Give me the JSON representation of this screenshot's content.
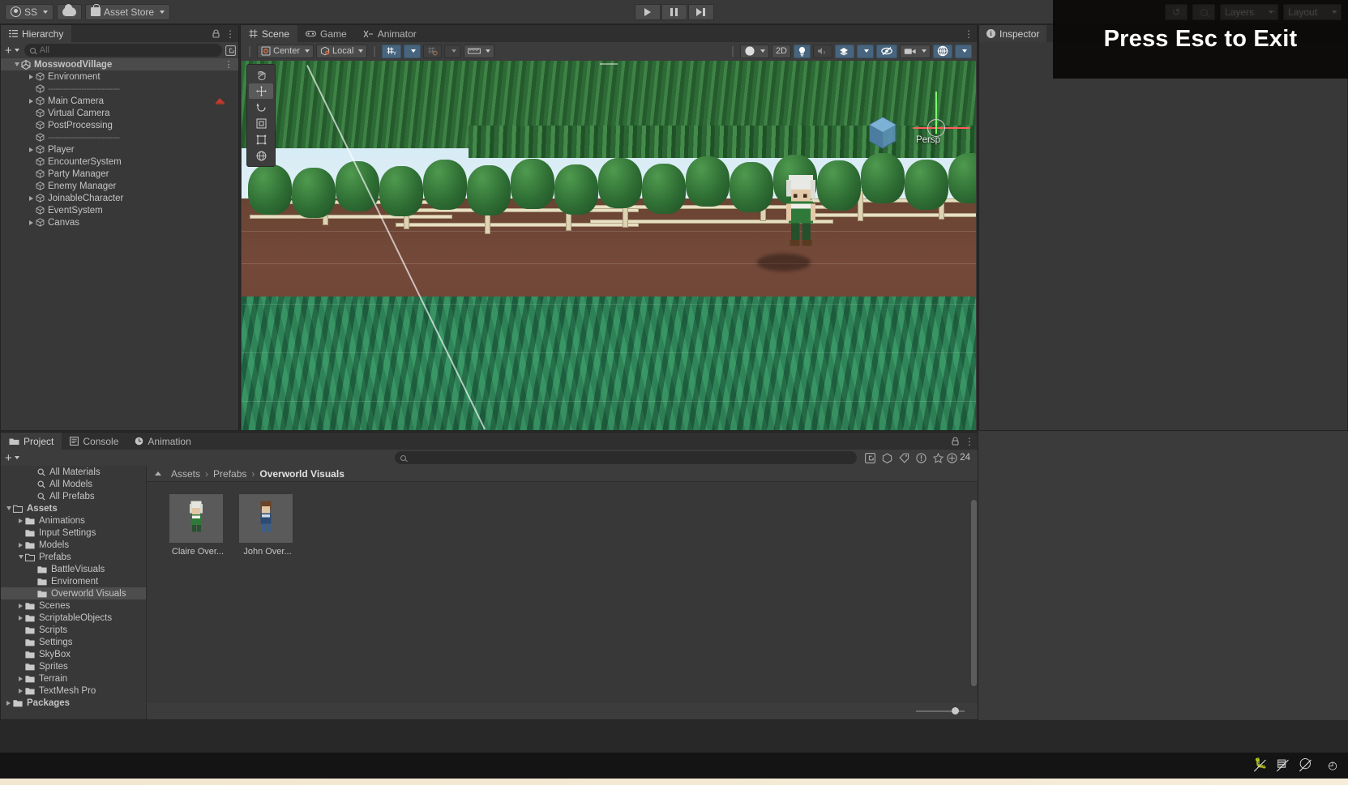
{
  "app": {
    "toolbar": {
      "account_label": "SS",
      "cloud_icon": "cloud-icon",
      "asset_store_label": "Asset Store",
      "play_icon": "play-icon",
      "pause_icon": "pause-icon",
      "step_icon": "step-icon",
      "history_icon": "history-icon",
      "search_icon": "search-icon",
      "layers_label": "Layers",
      "layout_label": "Layout"
    }
  },
  "overlay": {
    "message": "Press Esc to Exit"
  },
  "hierarchy": {
    "tab_label": "Hierarchy",
    "lock_icon": "lock-icon",
    "menu_icon": "kebab-menu-icon",
    "add_label": "+",
    "search_placeholder": "All",
    "rows": [
      {
        "label": "MosswoodVillage",
        "depth": 0,
        "arrow": "open",
        "icon": "unity-logo-icon",
        "selected": true,
        "menu": true
      },
      {
        "label": "Environment",
        "depth": 1,
        "arrow": "closed",
        "icon": "gameobject-icon",
        "selected": false,
        "menu": false
      },
      {
        "label": "----------------------------",
        "depth": 1,
        "arrow": "none",
        "icon": "gameobject-icon",
        "selected": false,
        "menu": false
      },
      {
        "label": "Main Camera",
        "depth": 1,
        "arrow": "closed",
        "icon": "gameobject-icon",
        "selected": false,
        "menu": false,
        "badge": "camera-preview-badge"
      },
      {
        "label": "Virtual Camera",
        "depth": 1,
        "arrow": "none",
        "icon": "gameobject-icon",
        "selected": false,
        "menu": false
      },
      {
        "label": "PostProcessing",
        "depth": 1,
        "arrow": "none",
        "icon": "gameobject-icon",
        "selected": false,
        "menu": false
      },
      {
        "label": "----------------------------",
        "depth": 1,
        "arrow": "none",
        "icon": "gameobject-icon",
        "selected": false,
        "menu": false
      },
      {
        "label": "Player",
        "depth": 1,
        "arrow": "closed",
        "icon": "gameobject-icon",
        "selected": false,
        "menu": false
      },
      {
        "label": "EncounterSystem",
        "depth": 1,
        "arrow": "none",
        "icon": "gameobject-icon",
        "selected": false,
        "menu": false
      },
      {
        "label": "Party Manager",
        "depth": 1,
        "arrow": "none",
        "icon": "gameobject-icon",
        "selected": false,
        "menu": false
      },
      {
        "label": "Enemy Manager",
        "depth": 1,
        "arrow": "none",
        "icon": "gameobject-icon",
        "selected": false,
        "menu": false
      },
      {
        "label": "JoinableCharacter",
        "depth": 1,
        "arrow": "closed",
        "icon": "gameobject-icon",
        "selected": false,
        "menu": false
      },
      {
        "label": "EventSystem",
        "depth": 1,
        "arrow": "none",
        "icon": "gameobject-icon",
        "selected": false,
        "menu": false
      },
      {
        "label": "Canvas",
        "depth": 1,
        "arrow": "closed",
        "icon": "gameobject-icon",
        "selected": false,
        "menu": false
      }
    ]
  },
  "scene": {
    "tabs": [
      {
        "label": "Scene",
        "icon": "grid-icon",
        "active": true
      },
      {
        "label": "Game",
        "icon": "gamepad-icon",
        "active": false
      },
      {
        "label": "Animator",
        "icon": "animator-icon",
        "active": false
      }
    ],
    "menu_icon": "kebab-menu-icon",
    "toolbar": {
      "pivot_label": "Center",
      "handle_label": "Local",
      "grid_icon": "grid-axis-icon",
      "snap_icon": "grid-snap-icon",
      "ruler_icon": "ruler-icon",
      "shading_icon": "shading-mode-icon",
      "twod_label": "2D",
      "light_icon": "lighting-icon",
      "audio_icon": "audio-mute-icon",
      "fx_icon": "effects-icon",
      "hidden_icon": "scene-visibility-icon",
      "camera_icon": "scene-camera-icon",
      "gizmos_icon": "gizmos-icon"
    },
    "tools": [
      {
        "icon": "hand-tool-icon",
        "active": false
      },
      {
        "icon": "move-tool-icon",
        "active": true
      },
      {
        "icon": "rotate-tool-icon",
        "active": false
      },
      {
        "icon": "scale-tool-icon",
        "active": false
      },
      {
        "icon": "rect-tool-icon",
        "active": false
      },
      {
        "icon": "transform-tool-icon",
        "active": false
      }
    ],
    "orientation_label": "Persp",
    "gizmo_icon": "orientation-gizmo-icon"
  },
  "inspector": {
    "tab_label": "Inspector",
    "icon": "info-icon",
    "lock_icon": "lock-icon",
    "menu_icon": "kebab-menu-icon"
  },
  "project": {
    "tabs": [
      {
        "label": "Project",
        "icon": "folder-icon",
        "active": true
      },
      {
        "label": "Console",
        "icon": "console-icon",
        "active": false
      },
      {
        "label": "Animation",
        "icon": "animation-clock-icon",
        "active": false
      }
    ],
    "lock_icon": "lock-icon",
    "menu_icon": "kebab-menu-icon",
    "add_label": "+",
    "search_placeholder": "",
    "search_value": "",
    "filter_icons": [
      "save-search-icon",
      "search-by-type-icon",
      "search-by-label-icon",
      "warning-icon",
      "favorite-icon"
    ],
    "item_count": "24",
    "tree": [
      {
        "label": "All Materials",
        "depth": 2,
        "icon": "search-icon",
        "arrow": "none",
        "selected": false,
        "bold": false
      },
      {
        "label": "All Models",
        "depth": 2,
        "icon": "search-icon",
        "arrow": "none",
        "selected": false,
        "bold": false
      },
      {
        "label": "All Prefabs",
        "depth": 2,
        "icon": "search-icon",
        "arrow": "none",
        "selected": false,
        "bold": false
      },
      {
        "label": "Assets",
        "depth": 0,
        "icon": "folder-open-icon",
        "arrow": "open",
        "selected": false,
        "bold": true
      },
      {
        "label": "Animations",
        "depth": 1,
        "icon": "folder-icon",
        "arrow": "closed",
        "selected": false,
        "bold": false
      },
      {
        "label": "Input Settings",
        "depth": 1,
        "icon": "folder-icon",
        "arrow": "none",
        "selected": false,
        "bold": false
      },
      {
        "label": "Models",
        "depth": 1,
        "icon": "folder-icon",
        "arrow": "closed",
        "selected": false,
        "bold": false
      },
      {
        "label": "Prefabs",
        "depth": 1,
        "icon": "folder-open-icon",
        "arrow": "open",
        "selected": false,
        "bold": false
      },
      {
        "label": "BattleVisuals",
        "depth": 2,
        "icon": "folder-icon",
        "arrow": "none",
        "selected": false,
        "bold": false
      },
      {
        "label": "Enviroment",
        "depth": 2,
        "icon": "folder-icon",
        "arrow": "none",
        "selected": false,
        "bold": false
      },
      {
        "label": "Overworld Visuals",
        "depth": 2,
        "icon": "folder-icon",
        "arrow": "none",
        "selected": true,
        "bold": false
      },
      {
        "label": "Scenes",
        "depth": 1,
        "icon": "folder-icon",
        "arrow": "closed",
        "selected": false,
        "bold": false
      },
      {
        "label": "ScriptableObjects",
        "depth": 1,
        "icon": "folder-icon",
        "arrow": "closed",
        "selected": false,
        "bold": false
      },
      {
        "label": "Scripts",
        "depth": 1,
        "icon": "folder-icon",
        "arrow": "none",
        "selected": false,
        "bold": false
      },
      {
        "label": "Settings",
        "depth": 1,
        "icon": "folder-icon",
        "arrow": "none",
        "selected": false,
        "bold": false
      },
      {
        "label": "SkyBox",
        "depth": 1,
        "icon": "folder-icon",
        "arrow": "none",
        "selected": false,
        "bold": false
      },
      {
        "label": "Sprites",
        "depth": 1,
        "icon": "folder-icon",
        "arrow": "none",
        "selected": false,
        "bold": false
      },
      {
        "label": "Terrain",
        "depth": 1,
        "icon": "folder-icon",
        "arrow": "closed",
        "selected": false,
        "bold": false
      },
      {
        "label": "TextMesh Pro",
        "depth": 1,
        "icon": "folder-icon",
        "arrow": "closed",
        "selected": false,
        "bold": false
      },
      {
        "label": "Packages",
        "depth": 0,
        "icon": "folder-icon",
        "arrow": "closed",
        "selected": false,
        "bold": true
      }
    ],
    "breadcrumb": [
      "Assets",
      "Prefabs",
      "Overworld Visuals"
    ],
    "assets": [
      {
        "label": "Claire Over...",
        "icon": "prefab-thumbnail"
      },
      {
        "label": "John Over...",
        "icon": "prefab-thumbnail"
      }
    ],
    "zoom_slider_value": "75"
  },
  "taskbar": {
    "icons": [
      "bug-mute-icon",
      "layers-mute-icon",
      "screen-off-icon",
      "clock-icon"
    ]
  },
  "colors": {
    "panel_bg": "#383838",
    "toolbar_bg": "#3c3c3c",
    "tab_inactive": "#2f2f2f",
    "accent_blue": "#47657e",
    "selection": "#4d4d4d",
    "text": "#c4c4c4"
  }
}
